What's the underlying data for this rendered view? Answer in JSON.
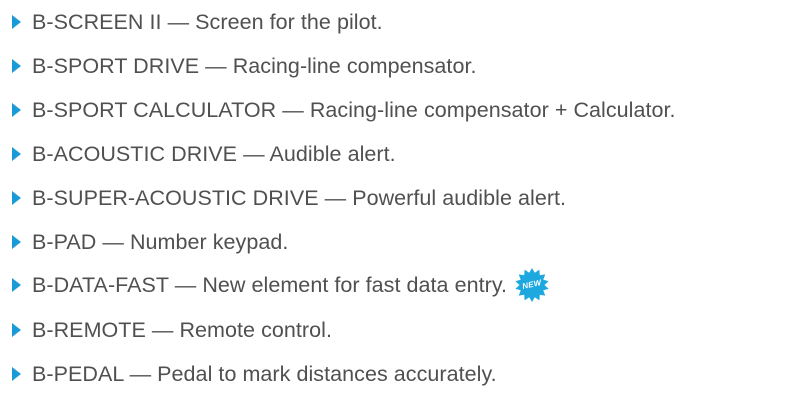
{
  "accent_color": "#1a9bd7",
  "badge_color": "#1ea8e0",
  "products": [
    {
      "text": "B-SCREEN II — Screen for the pilot."
    },
    {
      "text": "B-SPORT DRIVE — Racing-line compensator."
    },
    {
      "text": "B-SPORT CALCULATOR — Racing-line compensator + Calculator."
    },
    {
      "text": "B-ACOUSTIC DRIVE — Audible alert."
    },
    {
      "text": "B-SUPER-ACOUSTIC DRIVE — Powerful audible alert."
    },
    {
      "text": "B-PAD — Number keypad."
    },
    {
      "text": "B-DATA-FAST — New element for fast data entry.",
      "badge": "NEW"
    },
    {
      "text": "B-REMOTE — Remote control."
    },
    {
      "text": "B-PEDAL — Pedal to mark distances accurately."
    }
  ]
}
